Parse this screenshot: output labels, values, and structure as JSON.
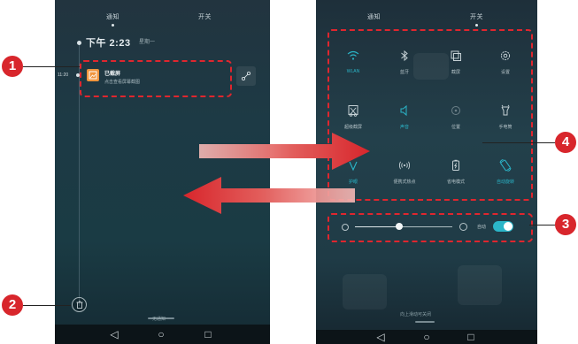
{
  "left_screen": {
    "tabs": [
      "通知",
      "开关"
    ],
    "clock": {
      "time": "下午 2:23",
      "date": "星期一"
    },
    "notification": {
      "time": "11:20",
      "title": "已截屏",
      "subtitle": "点击查看屏幕截图"
    },
    "bottom_hint": "无通知"
  },
  "right_screen": {
    "tabs": [
      "通知",
      "开关"
    ],
    "tiles": [
      {
        "icon": "wifi-icon",
        "label": "WLAN",
        "on": true
      },
      {
        "icon": "bluetooth-icon",
        "label": "蓝牙",
        "on": false
      },
      {
        "icon": "screenshot-icon",
        "label": "截屏",
        "on": false
      },
      {
        "icon": "settings-icon",
        "label": "设置",
        "on": false
      },
      {
        "icon": "scissors-icon",
        "label": "超级截屏",
        "on": false
      },
      {
        "icon": "sound-icon",
        "label": "声音",
        "on": true
      },
      {
        "icon": "location-icon",
        "label": "位置",
        "on": false
      },
      {
        "icon": "flashlight-icon",
        "label": "手电筒",
        "on": false
      },
      {
        "icon": "eye-comfort-icon",
        "label": "护眼",
        "on": true
      },
      {
        "icon": "hotspot-icon",
        "label": "便携式热点",
        "on": false
      },
      {
        "icon": "power-saving-icon",
        "label": "省电模式",
        "on": false
      },
      {
        "icon": "auto-rotate-icon",
        "label": "自动旋转",
        "on": true
      }
    ],
    "brightness": {
      "level": 0.45,
      "auto_label": "自动",
      "auto_on": true
    },
    "bottom_hint": "向上滑动可关闭"
  },
  "callouts": [
    "1",
    "2",
    "3",
    "4"
  ],
  "colors": {
    "callout": "#d8262c",
    "accent": "#2bb5c8",
    "arrow": "#d8262c"
  }
}
